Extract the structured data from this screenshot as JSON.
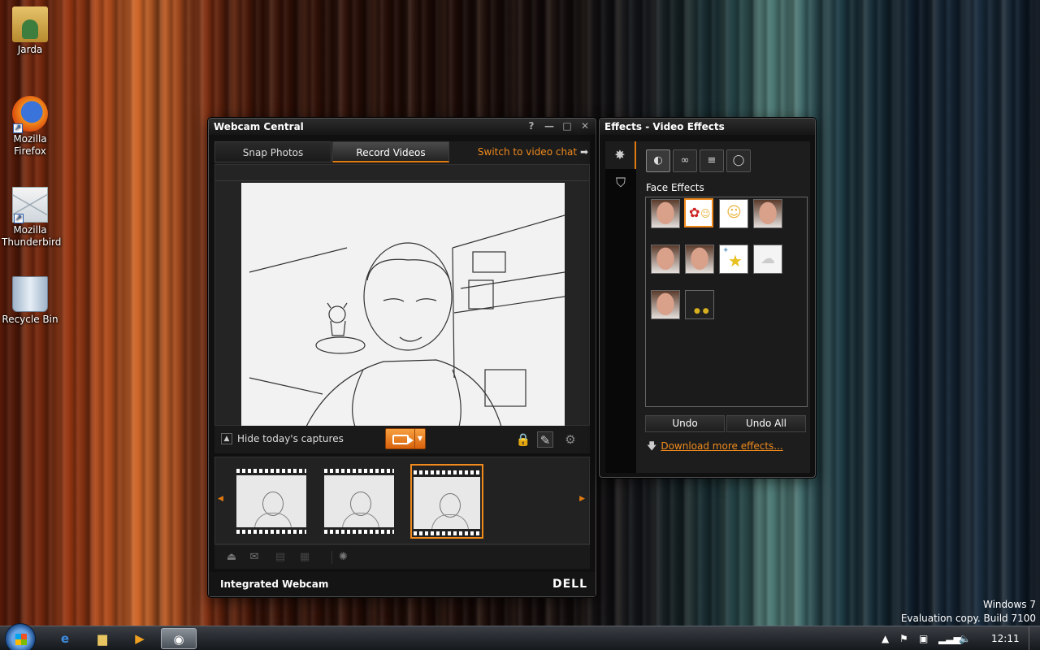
{
  "desktop": {
    "icons": [
      {
        "label": "Jarda",
        "icon": "user-folder-icon"
      },
      {
        "label": "Mozilla Firefox",
        "icon": "firefox-icon"
      },
      {
        "label": "Mozilla Thunderbird",
        "icon": "thunderbird-icon"
      },
      {
        "label": "Recycle Bin",
        "icon": "recycle-bin-icon"
      }
    ],
    "watermark": {
      "line1": "Windows 7",
      "line2": "Evaluation copy. Build 7100"
    }
  },
  "webcam": {
    "title": "Webcam Central",
    "title_buttons": [
      "?",
      "—",
      "□",
      "✕"
    ],
    "tabs": [
      {
        "label": "Snap Photos",
        "active": false
      },
      {
        "label": "Record Videos",
        "active": true
      }
    ],
    "switch_link": "Switch to video chat",
    "hide_captures": "Hide today's captures",
    "captures_count": 3,
    "selected_capture": 3,
    "device_label": "Integrated Webcam",
    "brand": "DELL",
    "accent": "#f08a1c"
  },
  "effects": {
    "title": "Effects - Video Effects",
    "section_title": "Face Effects",
    "category_tabs": [
      "face-effects-icon",
      "glasses-icon",
      "layers-icon",
      "bubble-icon"
    ],
    "undo": "Undo",
    "undo_all": "Undo All",
    "download_link": "Download more effects...",
    "selected_effect": 2
  },
  "taskbar": {
    "time": "12:11",
    "items": [
      "internet-explorer-icon",
      "explorer-icon",
      "media-player-icon",
      "webcam-icon"
    ]
  }
}
